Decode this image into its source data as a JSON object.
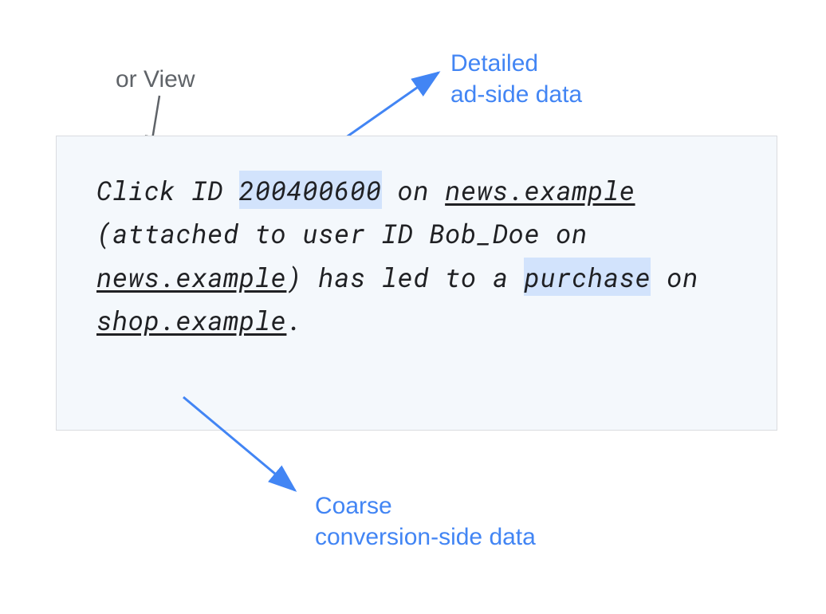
{
  "annotations": {
    "or_view": "or View",
    "detailed_line1": "Detailed",
    "detailed_line2": "ad-side data",
    "coarse_line1": "Coarse",
    "coarse_line2": "conversion-side data"
  },
  "content": {
    "p1": "Click ID ",
    "click_id": "200400600",
    "p2": " on ",
    "domain1": "news.example",
    "p3": " (attached to user ID Bob_Doe on ",
    "domain1b": "news.example",
    "p4": ") has led to a ",
    "purchase": "purchase",
    "p5": " on ",
    "domain2": "shop.example",
    "p6": "."
  }
}
